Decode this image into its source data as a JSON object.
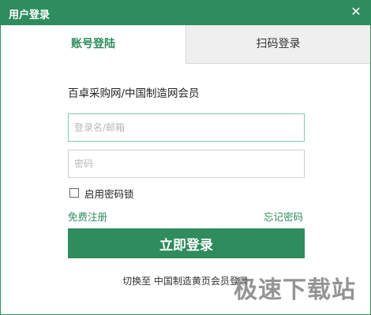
{
  "window": {
    "title": "用户登录",
    "close_glyph": "✕"
  },
  "tabs": [
    {
      "label": "账号登陆",
      "active": true
    },
    {
      "label": "扫码登录",
      "active": false
    }
  ],
  "form": {
    "member_label": "百卓采购网/中国制造网会员",
    "username": {
      "value": "",
      "placeholder": "登录名/邮箱"
    },
    "password": {
      "value": "",
      "placeholder": "密码"
    },
    "remember_label": "启用密码锁",
    "remember_checked": false,
    "register_link": "免费注册",
    "forgot_link": "忘记密码",
    "login_button": "立即登录"
  },
  "footer": {
    "switch_prefix": "切换至",
    "switch_link": "中国制造黄页会员登录"
  },
  "watermark": "极速下载站",
  "colors": {
    "brand": "#2e8c5d",
    "inactive_tab_bg": "#efefef"
  },
  "icons": {
    "close": "close-icon",
    "checkbox": "checkbox-icon"
  }
}
